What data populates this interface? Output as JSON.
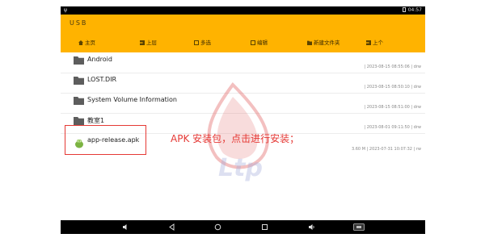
{
  "status_bar": {
    "time": "04:57",
    "left_icon": "usb-debug-icon"
  },
  "app_bar": {
    "title": "USB"
  },
  "toolbar": {
    "home": "主页",
    "up_level": "上层",
    "multi_select": "多选",
    "edit": "编辑",
    "new_folder": "新建文件夹",
    "previous": "上个"
  },
  "files": [
    {
      "name": "Android",
      "meta": "| 2023-08-15 08:55:06 | drw",
      "icon": "folder-icon"
    },
    {
      "name": "LOST.DIR",
      "meta": "| 2023-08-15 08:50:10 | drw",
      "icon": "folder-icon"
    },
    {
      "name": "System Volume Information",
      "meta": "| 2023-08-15 08:51:00 | drw",
      "icon": "folder-icon"
    },
    {
      "name": "教室1",
      "meta": "| 2023-08-01 09:11:50 | drw",
      "icon": "folder-icon"
    },
    {
      "name": "app-release.apk",
      "meta": "3.60 M | 2023-07-31 10:07:32 | rw",
      "icon": "android-apk-icon"
    }
  ],
  "annotation": {
    "text": "APK 安装包，点击进行安装；",
    "color": "#e53935"
  },
  "colors": {
    "app_bar": "#ffb300",
    "annotation": "#e53935",
    "folder": "#5d5d5d",
    "watermark": "#e57373"
  },
  "nav_bar": {
    "icons": [
      "volume-down-icon",
      "back-icon",
      "home-circle-icon",
      "recents-icon",
      "volume-up-icon",
      "screenshot-icon"
    ]
  }
}
